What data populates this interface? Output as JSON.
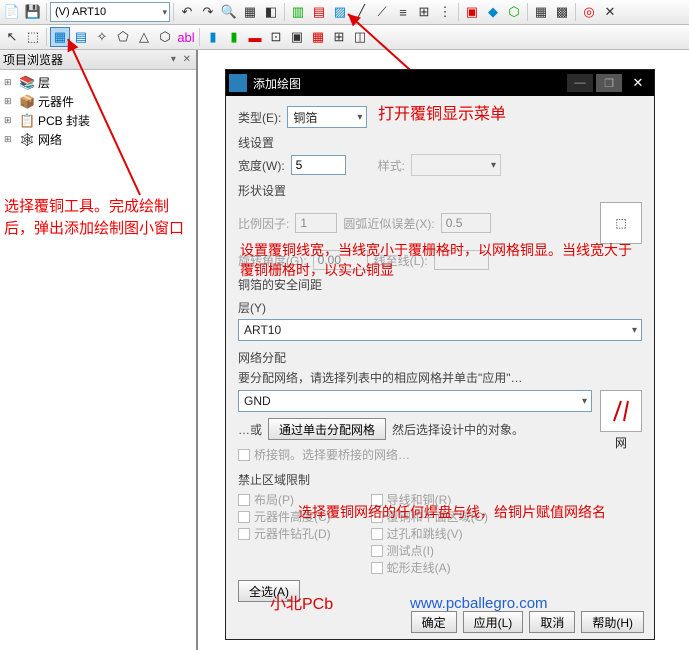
{
  "toolbar": {
    "layer_combo": "(V) ART10"
  },
  "sidebar": {
    "title": "项目浏览器",
    "items": [
      {
        "icon": "📚",
        "label": "层"
      },
      {
        "icon": "📦",
        "label": "元器件"
      },
      {
        "icon": "📋",
        "label": "PCB 封装"
      },
      {
        "icon": "🕸",
        "label": "网络"
      }
    ]
  },
  "dialog": {
    "title": "添加绘图",
    "type_label": "类型(E):",
    "type_value": "铜箔",
    "line_section": "线设置",
    "width_label": "宽度(W):",
    "width_value": "5",
    "style_label": "样式:",
    "shape_section": "形状设置",
    "scale_label": "比例因子:",
    "scale_value": "1",
    "tol_label": "圆弧近似误差(X):",
    "tol_value": "0.5",
    "rotate_label": "旋转角度(G):",
    "rotate_value": "0.00",
    "stretch_label": "线至线(L):",
    "copper_clear_label": "铜箔的安全间距",
    "layer_section": "层(Y)",
    "layer_value": "ART10",
    "net_section": "网络分配",
    "net_hint": "要分配网络，请选择列表中的相应网格并单击\"应用\"…",
    "net_value": "GND",
    "net_or": "…或",
    "net_btn": "通过单击分配网格",
    "net_after": "然后选择设计中的对象。",
    "bridge_label": "桥接铜。选择要桥接的网络…",
    "keepout_section": "禁止区域限制",
    "k1": "布局(P)",
    "k2": "导线和铜(R)",
    "k3": "元器件高度(C)",
    "k4": "覆铜和平面区域(O)",
    "k5": "元器件钻孔(D)",
    "k6": "过孔和跳线(V)",
    "k7": "测试点(I)",
    "k8": "蛇形走线(A)",
    "select_all": "全选(A)",
    "net_icon_label": "网",
    "ok": "确定",
    "apply": "应用(L)",
    "cancel": "取消",
    "help": "帮助(H)"
  },
  "annotations": {
    "a1": "打开覆铜显示菜单",
    "a2": "选择覆铜工具。完成绘制后，弹出添加绘制图小窗口",
    "a3": "设置覆铜线宽，当线宽小于覆栅格时，以网格铜显。当线宽大于覆铜栅格时，以实心铜显",
    "a4": "选择覆铜网络的任何焊盘与线，给铜片赋值网络名",
    "brand": "小北PCb",
    "url": "www.pcballegro.com"
  }
}
